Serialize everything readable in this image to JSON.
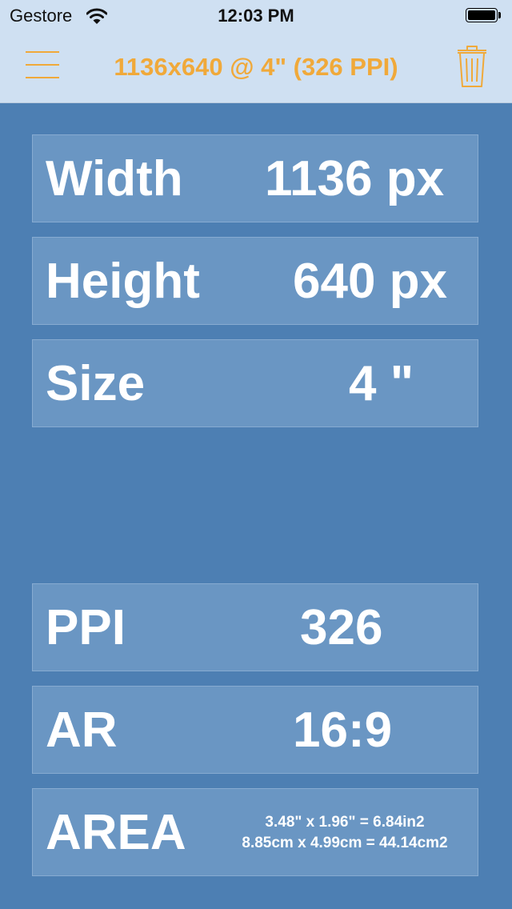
{
  "status_bar": {
    "carrier": "Gestore",
    "time": "12:03 PM",
    "battery_level": "full"
  },
  "nav_bar": {
    "title": "1136x640 @ 4\" (326 PPI)",
    "left_icon": "hamburger-menu-icon",
    "right_icon": "trash-icon",
    "accent_color": "#f0a93a"
  },
  "inputs": [
    {
      "label": "Width",
      "value": "1136 px"
    },
    {
      "label": "Height",
      "value": "640 px"
    },
    {
      "label": "Size",
      "value": "4 \""
    }
  ],
  "results": {
    "ppi": {
      "label": "PPI",
      "value": "326"
    },
    "ar": {
      "label": "AR",
      "value": "16:9"
    },
    "area": {
      "label": "AREA",
      "inches": "3.48\" x 1.96\" = 6.84in2",
      "centimeters": "8.85cm x 4.99cm = 44.14cm2"
    }
  },
  "colors": {
    "background": "#4d7fb3",
    "row_background": "#6a96c3",
    "header_background": "#cfe0f2",
    "text": "#ffffff"
  }
}
